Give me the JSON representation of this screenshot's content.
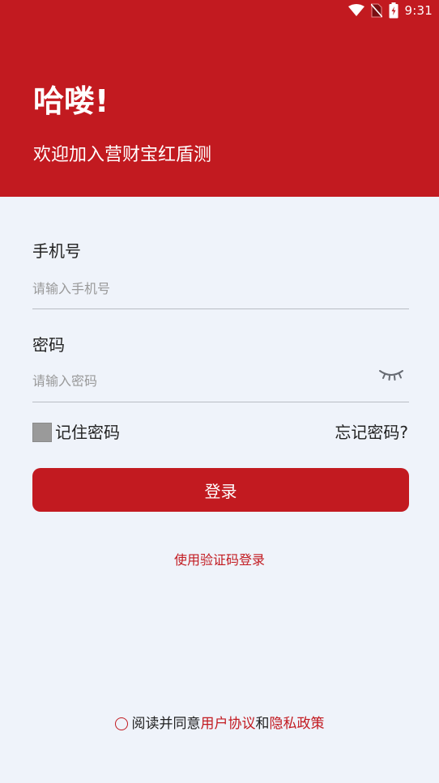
{
  "status_bar": {
    "time": "9:31",
    "icons": [
      "wifi-icon",
      "no-sim-icon",
      "battery-charging-icon"
    ]
  },
  "header": {
    "greeting": "哈喽!",
    "subtitle": "欢迎加入营财宝红盾测"
  },
  "form": {
    "phone": {
      "label": "手机号",
      "placeholder": "请输入手机号",
      "value": ""
    },
    "password": {
      "label": "密码",
      "placeholder": "请输入密码",
      "value": "",
      "toggle_icon": "eye-closed-icon"
    },
    "remember_label": "记住密码",
    "forgot_label": "忘记密码?",
    "login_label": "登录",
    "sms_login_label": "使用验证码登录"
  },
  "agreement": {
    "prefix": "阅读并同意",
    "user_agreement": "用户协议",
    "and": "和",
    "privacy_policy": "隐私政策"
  },
  "colors": {
    "brand": "#c21a20",
    "background": "#eff3fa"
  }
}
